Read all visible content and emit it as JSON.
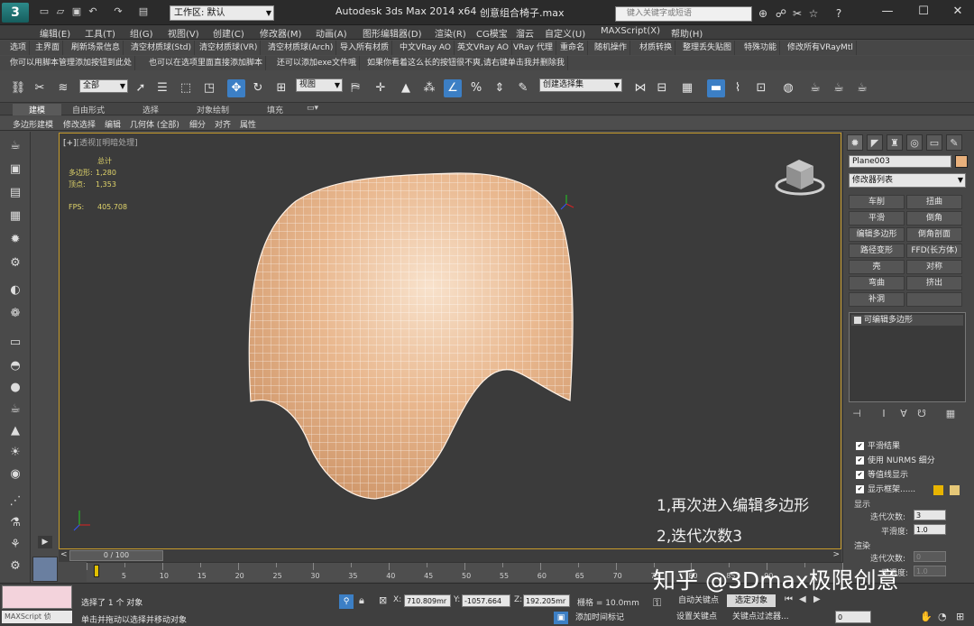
{
  "title": {
    "app": "Autodesk 3ds Max  2014 x64",
    "file": "创意组合椅子.max",
    "workspace": "工作区: 默认",
    "search_placeholder": "键入关键字或短语"
  },
  "menu": [
    "编辑(E)",
    "工具(T)",
    "组(G)",
    "视图(V)",
    "创建(C)",
    "修改器(M)",
    "动画(A)",
    "图形编辑器(D)",
    "渲染(R)",
    "CG模宝",
    "溜云",
    "自定义(U)",
    "MAXScript(X)",
    "帮助(H)"
  ],
  "custom_row1": [
    "选项",
    "主界面",
    "刷新场景信息",
    "清空材质球(Std)",
    "清空材质球(VR)",
    "清空材质球(Arch)",
    "导入所有材质",
    "中文VRay AO",
    "英文VRay AO",
    "VRay 代理",
    "重命名",
    "随机操作",
    "材质转换",
    "整理丢失贴图",
    "特殊功能",
    "修改所有VRayMtl"
  ],
  "custom_row2": [
    "你可以用脚本管理添加按钮到此处",
    "也可以在选项里面直接添加脚本",
    "还可以添加exe文件哦",
    "如果你看着这么长的按钮很不爽,请右键单击我并删除我"
  ],
  "main_toolbar": {
    "filter": "全部",
    "refcoord": "视图",
    "selset": "创建选择集"
  },
  "ribbon_tabs": [
    "建模",
    "自由形式",
    "选择",
    "对象绘制",
    "填充"
  ],
  "ribbon_sub": [
    "多边形建模",
    "修改选择",
    "编辑",
    "几何体 (全部)",
    "细分",
    "对齐",
    "属性"
  ],
  "viewport": {
    "label_plus": "[+]",
    "label_view": "[透视]",
    "label_shade": "[明暗处理]",
    "stats_header": "总计",
    "polys_label": "多边形:",
    "polys_value": "1,280",
    "verts_label": "顶点:",
    "verts_value": "1,353",
    "fps_label": "FPS:",
    "fps_value": "405.708",
    "note1": "1,再次进入编辑多边形",
    "note2": "2,迭代次数3"
  },
  "command_panel": {
    "object_name": "Plane003",
    "object_color": "#e8b07c",
    "modifier_list": "修改器列表",
    "mod_buttons": [
      "车削",
      "扭曲",
      "平滑",
      "倒角",
      "编辑多边形",
      "倒角剖面",
      "路径变形",
      "FFD(长方体)",
      "壳",
      "对称",
      "弯曲",
      "挤出",
      "补洞"
    ],
    "stack_item": "可编辑多边形",
    "checkboxes": [
      "平滑结果",
      "使用 NURMS 细分",
      "等值线显示",
      "显示框架......"
    ],
    "display_group": "显示",
    "iter_label": "迭代次数:",
    "iter_value": "3",
    "smooth_label": "平滑度:",
    "smooth_value": "1.0",
    "render_group": "渲染",
    "r_iter_label": "迭代次数:",
    "r_iter_value": "0",
    "r_smooth_label": "平滑度:",
    "r_smooth_value": "1.0"
  },
  "timeline": {
    "range": "0 / 100",
    "ticks": [
      "5",
      "10",
      "15",
      "20",
      "25",
      "30",
      "35",
      "40",
      "45",
      "50",
      "55",
      "60",
      "65",
      "70",
      "75",
      "80",
      "85",
      "90"
    ]
  },
  "status": {
    "maxscript": "MAXScript 侦",
    "line1": "选择了 1 个 对象",
    "line2": "单击并拖动以选择并移动对象",
    "x_label": "X:",
    "x_value": "710.809mr",
    "y_label": "Y:",
    "y_value": "-1057.664",
    "z_label": "Z:",
    "z_value": "192.205mr",
    "grid": "栅格 = 10.0mm",
    "autokey": "自动关键点",
    "selected": "选定对象",
    "setkey": "设置关键点",
    "keyfilter": "关键点过滤器...",
    "addtime": "添加时间标记",
    "frame": "0"
  },
  "watermark": "知乎 @3Dmax极限创意"
}
